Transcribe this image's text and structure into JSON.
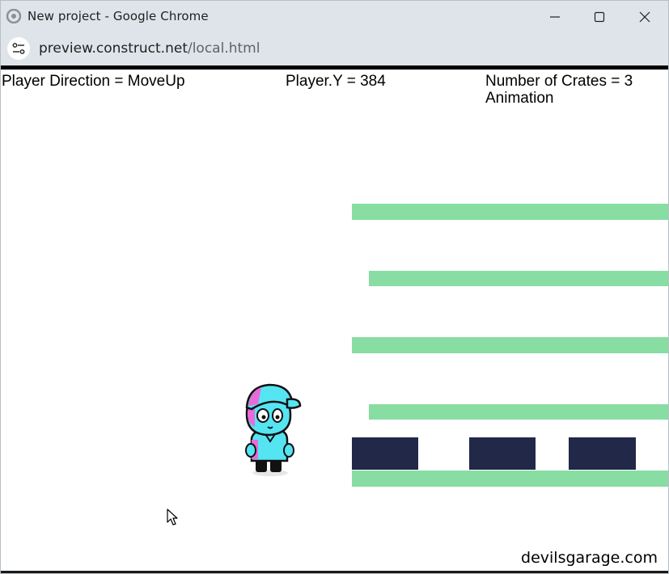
{
  "window": {
    "title": "New project - Google Chrome",
    "controls": [
      "minimize-icon",
      "maximize-icon",
      "close-icon"
    ]
  },
  "address": {
    "host": "preview.construct.net",
    "path": "/local.html",
    "site_info_icon": "tune-icon"
  },
  "hud": {
    "direction": "Player Direction = MoveUp",
    "player_y": "Player.Y = 384",
    "crates": "Number of Crates = 3",
    "animation": "Animation"
  },
  "game": {
    "platform_color": "#88dda3",
    "crate_color": "#222847",
    "player_sprite": "player-character",
    "watermark": "devilsgarage.com"
  }
}
